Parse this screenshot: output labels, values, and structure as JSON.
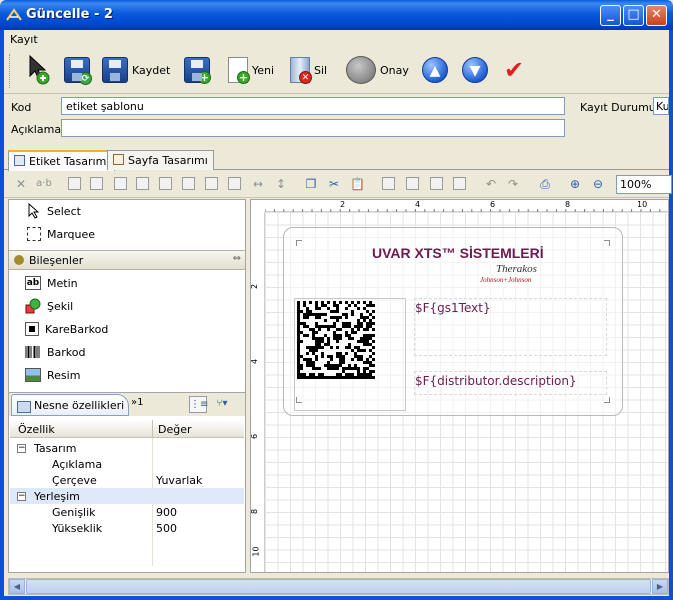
{
  "window": {
    "title": "Güncelle - 2"
  },
  "menu": {
    "items": [
      "Kayıt"
    ]
  },
  "toolbar": {
    "kaydet": "Kaydet",
    "yeni": "Yeni",
    "sil": "Sil",
    "onay": "Onay"
  },
  "form": {
    "kod_label": "Kod",
    "kod_value": "etiket şablonu",
    "aciklama_label": "Açıklama",
    "aciklama_value": "",
    "kayit_durumu_label": "Kayıt Durumu",
    "kayit_durumu_value": "Ku"
  },
  "tabs": [
    "Etiket Tasarımı",
    "Sayfa Tasarımı"
  ],
  "active_tab": 0,
  "zoom": "100%",
  "palette": {
    "select": "Select",
    "marquee": "Marquee",
    "components_header": "Bileşenler",
    "items": [
      "Metin",
      "Şekil",
      "KareBarkod",
      "Barkod",
      "Resim"
    ]
  },
  "properties": {
    "tab_label": "Nesne özellikleri",
    "tab2_label": "»1",
    "col_property": "Özellik",
    "col_value": "Değer",
    "rows": [
      {
        "key": "Tasarım",
        "value": "",
        "group": true
      },
      {
        "key": "Açıklama",
        "value": ""
      },
      {
        "key": "Çerçeve",
        "value": "Yuvarlak"
      },
      {
        "key": "Yerleşim",
        "value": "",
        "group": true
      },
      {
        "key": "Genişlik",
        "value": "900"
      },
      {
        "key": "Yükseklik",
        "value": "500"
      }
    ]
  },
  "canvas": {
    "ruler_h": [
      "2",
      "4",
      "6",
      "8",
      "10"
    ],
    "ruler_v": [
      "2",
      "4",
      "6",
      "8",
      "10"
    ],
    "company": "UVAR XTS™ SİSTEMLERİ",
    "brand": "Therakos",
    "brand_sub": "Johnson+Johnson",
    "field1": "$F{gs1Text}",
    "field2": "$F{distributor.description}"
  },
  "colors": {
    "accent": "#6b1b4f",
    "titlebar": "#0a5adc"
  }
}
